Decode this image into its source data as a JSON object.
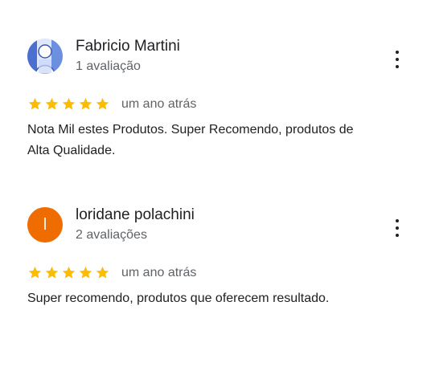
{
  "reviews": [
    {
      "author": "Fabricio Martini",
      "review_count": "1 avaliação",
      "avatar": {
        "type": "photo",
        "icon": "user-photo"
      },
      "rating": 5,
      "date": "um ano atrás",
      "text": "Nota Mil estes Produtos. Super Recomendo, produtos de Alta Qualidade."
    },
    {
      "author": "loridane polachini",
      "review_count": "2 avaliações",
      "avatar": {
        "type": "letter",
        "letter": "l",
        "color": "#ef6c00"
      },
      "rating": 5,
      "date": "um ano atrás",
      "text": "Super recomendo, produtos que oferecem resultado."
    }
  ],
  "colors": {
    "star": "#fbbc04",
    "text": "#202124",
    "secondary": "#5f6368"
  }
}
